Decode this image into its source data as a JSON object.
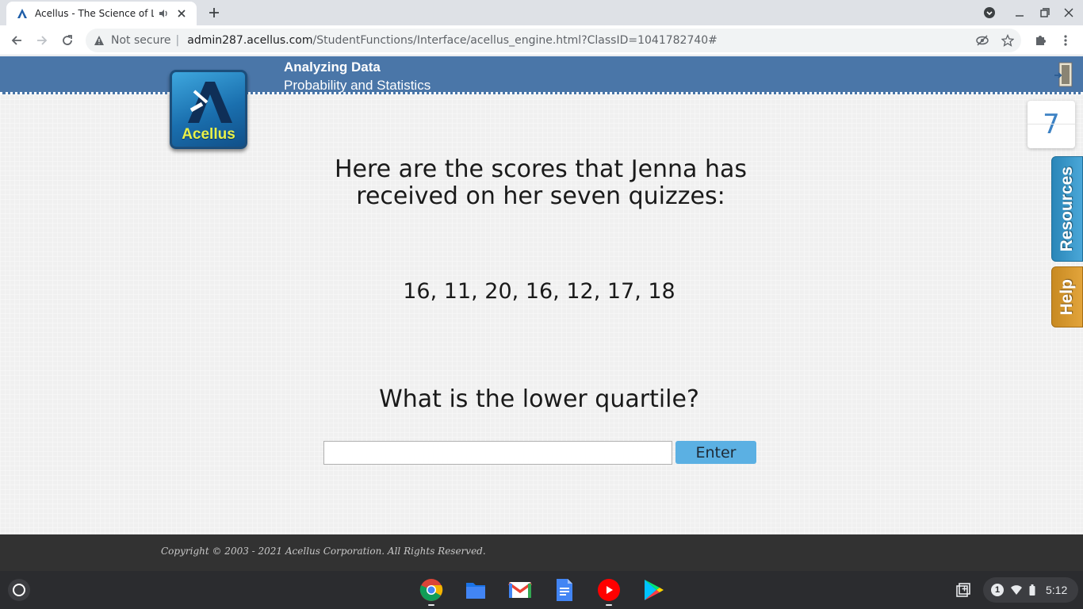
{
  "browser": {
    "tab_title": "Acellus - The Science of Learning",
    "security_label": "Not secure",
    "url_host": "admin287.acellus.com",
    "url_path": "/StudentFunctions/Interface/acellus_engine.html?ClassID=1041782740#"
  },
  "header": {
    "course_title": "Analyzing Data",
    "course_subtitle": "Probability and Statistics",
    "logo_text": "Acellus",
    "problem_counter": "7"
  },
  "sidebar": {
    "resources_label": "Resources",
    "help_label": "Help"
  },
  "question": {
    "text": "Here are the scores that Jenna has received on her seven quizzes:",
    "scores": "16, 11, 20, 16, 12, 17, 18",
    "prompt": "What is the lower quartile?",
    "answer_value": "",
    "enter_label": "Enter"
  },
  "footer": {
    "copyright": "Copyright © 2003 - 2021 Acellus Corporation.  All Rights Reserved."
  },
  "shelf": {
    "notification_count": "1",
    "time": "5:12",
    "apps": [
      "chrome-icon",
      "files-icon",
      "gmail-icon",
      "docs-icon",
      "youtube-icon",
      "play-store-icon"
    ]
  },
  "colors": {
    "banner": "#4a76a8",
    "accent_button": "#5bb0e3",
    "resources_tab": "#3a97cb",
    "help_tab": "#d6982e"
  }
}
